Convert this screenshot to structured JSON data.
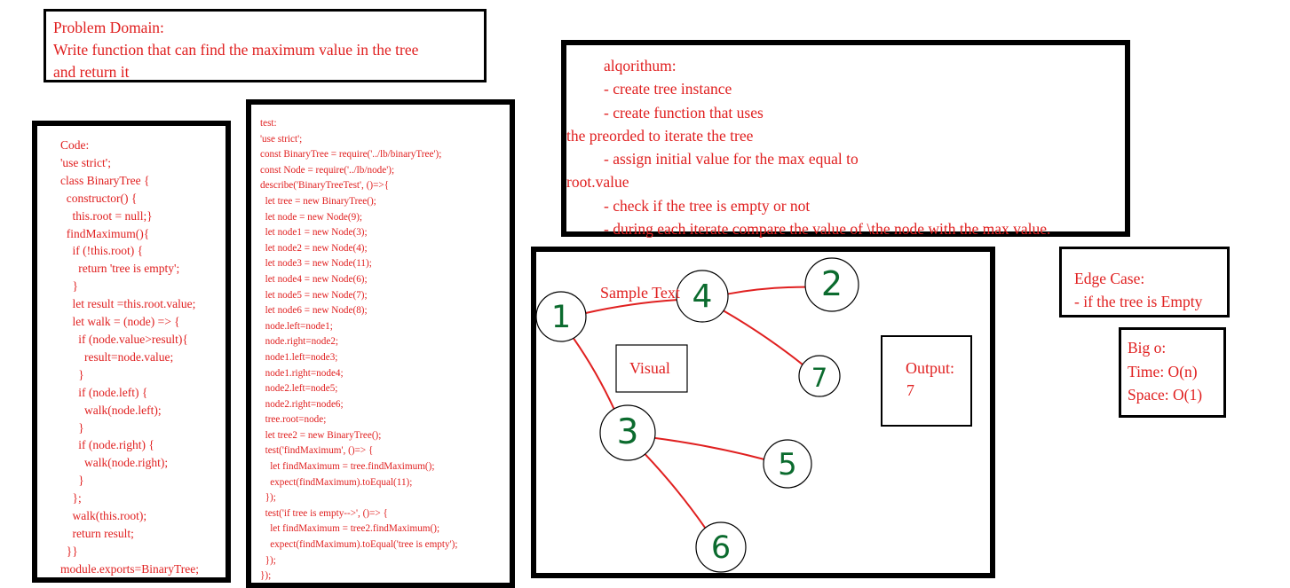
{
  "problem_domain": {
    "lines": [
      "Problem Domain:",
      "Write function that can find the maximum value in the tree",
      "and return it"
    ]
  },
  "algorithm": {
    "lines": [
      "alqorithum:",
      "- create tree instance",
      "- create function that uses",
      "the preorded to iterate the tree",
      "- assign initial value for the max equal to",
      "root.value",
      "- check if the tree is empty or not",
      "- during each iterate compare the value of \\the node with the max value."
    ]
  },
  "code": {
    "lines": [
      "Code:",
      "'use strict';",
      "class BinaryTree {",
      "  constructor() {",
      "    this.root = null;}",
      "  findMaximum(){",
      "    if (!this.root) {",
      "      return 'tree is empty';",
      "    }",
      "    let result =this.root.value;",
      "    let walk = (node) => {",
      "      if (node.value>result){",
      "        result=node.value;",
      "      }",
      "      if (node.left) {",
      "        walk(node.left);",
      "      }",
      "      if (node.right) {",
      "        walk(node.right);",
      "      }",
      "    };",
      "    walk(this.root);",
      "    return result;",
      "  }}",
      "module.exports=BinaryTree;"
    ]
  },
  "test": {
    "lines": [
      "test:",
      "'use strict';",
      "const BinaryTree = require('../lb/binaryTree');",
      "const Node = require('../lb/node');",
      "describe('BinaryTreeTest', ()=>{",
      "  let tree = new BinaryTree();",
      "  let node = new Node(9);",
      "  let node1 = new Node(3);",
      "  let node2 = new Node(4);",
      "  let node3 = new Node(11);",
      "  let node4 = new Node(6);",
      "  let node5 = new Node(7);",
      "  let node6 = new Node(8);",
      "  node.left=node1;",
      "  node.right=node2;",
      "  node1.left=node3;",
      "  node1.right=node4;",
      "  node2.left=node5;",
      "  node2.right=node6;",
      "  tree.root=node;",
      "  let tree2 = new BinaryTree();",
      "  test('findMaximum', ()=> {",
      "    let findMaximum = tree.findMaximum();",
      "    expect(findMaximum).toEqual(11);",
      "  });",
      "  test('if tree is empty-->', ()=> {",
      "    let findMaximum = tree2.findMaximum();",
      "    expect(findMaximum).toEqual('tree is empty');",
      "  });",
      "});"
    ]
  },
  "visual": {
    "sample_text": "Sample Text",
    "visual_label": "Visual",
    "output_label": "Output:",
    "output_value": "7",
    "nodes": [
      {
        "id": "n1",
        "label": "1"
      },
      {
        "id": "n4",
        "label": "4"
      },
      {
        "id": "n2",
        "label": "2"
      },
      {
        "id": "n7",
        "label": "7"
      },
      {
        "id": "n3",
        "label": "3"
      },
      {
        "id": "n5",
        "label": "5"
      },
      {
        "id": "n6",
        "label": "6"
      }
    ],
    "edges": [
      [
        "n1",
        "n4"
      ],
      [
        "n4",
        "n2"
      ],
      [
        "n4",
        "n7"
      ],
      [
        "n1",
        "n3"
      ],
      [
        "n3",
        "n5"
      ],
      [
        "n3",
        "n6"
      ]
    ],
    "edge_color": "#e02020",
    "digit_color": "#0b6b2e"
  },
  "edge_case": {
    "lines": [
      "Edge Case:",
      "- if the tree is Empty"
    ]
  },
  "big_o": {
    "lines": [
      "Big o:",
      "Time: O(n)",
      "Space: O(1)"
    ]
  },
  "colors": {
    "text": "#e02020",
    "border": "#000000"
  }
}
